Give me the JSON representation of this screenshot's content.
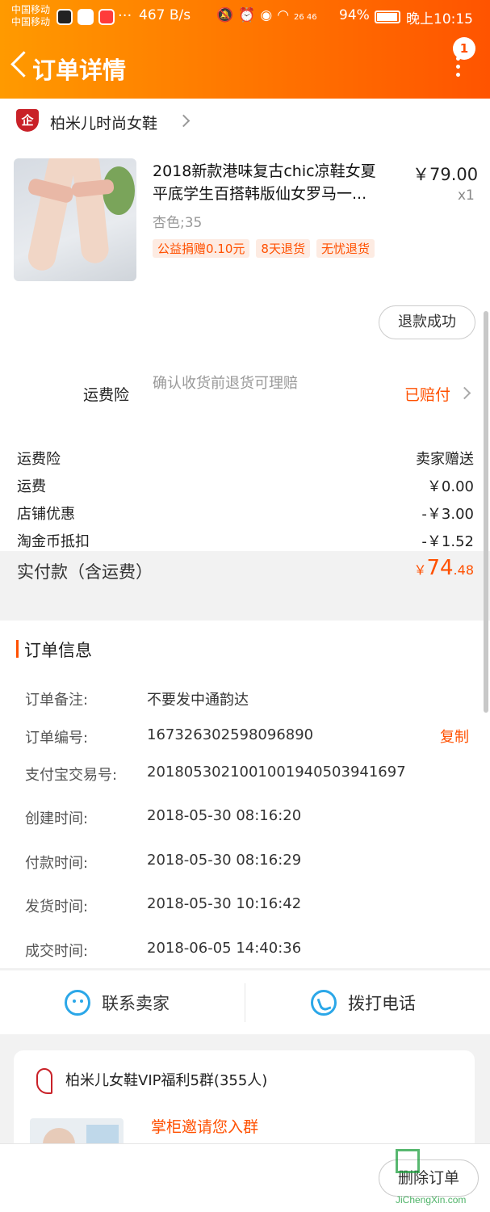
{
  "status_bar": {
    "carrier_1": "中国移动",
    "carrier_2": "中国移动",
    "dots": "···",
    "network_speed": "467 B/s",
    "signal_text": "26 46",
    "battery": "94%",
    "time": "晚上10:15"
  },
  "nav": {
    "title": "订单详情",
    "notification_count": "1"
  },
  "shop": {
    "logo_text": "企",
    "name": "柏米儿时尚女鞋"
  },
  "product": {
    "title_line1": "2018新款港味复古chic凉鞋女夏",
    "title_line2": "平底学生百搭韩版仙女罗马一...",
    "price": "￥79.00",
    "quantity": "x1",
    "sku": "杏色;35",
    "tags": [
      "公益捐赠0.10元",
      "8天退货",
      "无忧退货"
    ],
    "refund_status": "退款成功"
  },
  "insurance": {
    "label": "运费险",
    "description": "确认收货前退货可理赔",
    "status": "已赔付"
  },
  "fees": [
    {
      "label": "运费险",
      "value": "卖家赠送"
    },
    {
      "label": "运费",
      "value": "￥0.00"
    },
    {
      "label": "店铺优惠",
      "value": "-￥3.00"
    },
    {
      "label": "淘金币抵扣",
      "value": "-￥1.52"
    }
  ],
  "total": {
    "label": "实付款（含运费）",
    "currency": "￥",
    "integer": "74",
    "decimal": ".48"
  },
  "order_info": {
    "title": "订单信息",
    "copy_label": "复制",
    "rows": [
      {
        "key": "订单备注:",
        "value": "不要发中通韵达"
      },
      {
        "key": "订单编号:",
        "value": "167326302598096890"
      },
      {
        "key": "支付宝交易号:",
        "value": "2018053021001001940503941697"
      },
      {
        "key": "创建时间:",
        "value": "2018-05-30 08:16:20"
      },
      {
        "key": "付款时间:",
        "value": "2018-05-30 08:16:29"
      },
      {
        "key": "发货时间:",
        "value": "2018-05-30 10:16:42"
      },
      {
        "key": "成交时间:",
        "value": "2018-06-05 14:40:36"
      }
    ]
  },
  "contact": {
    "seller_label": "联系卖家",
    "phone_label": "拨打电话"
  },
  "group": {
    "name": "柏米儿女鞋VIP福利5群(355人)",
    "invite": "掌柜邀请您入群"
  },
  "bottom": {
    "delete_label": "删除订单"
  },
  "watermark": {
    "site": "JiChengXin.com"
  },
  "colors": {
    "accent": "#ff5000",
    "header_start": "#ff9a00",
    "header_end": "#ff5400",
    "contact_icon": "#2ba7e8"
  }
}
